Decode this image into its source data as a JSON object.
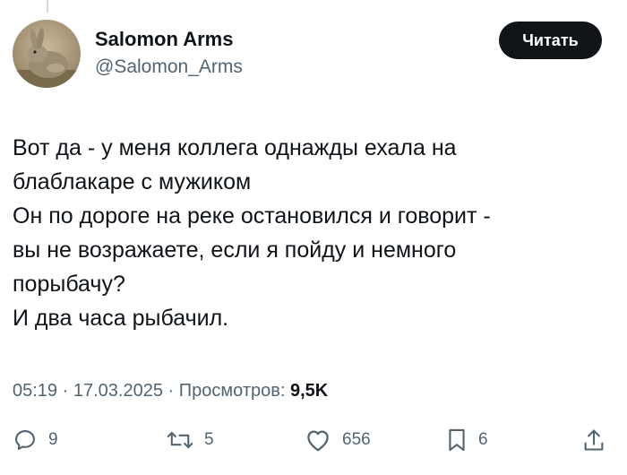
{
  "author": {
    "display_name": "Salomon Arms",
    "handle": "@Salomon_Arms",
    "avatar_icon": "rabbit-avatar"
  },
  "follow_button": {
    "label": "Читать"
  },
  "tweet": {
    "lines": [
      "Вот да - у меня коллега однажды ехала на",
      "блаблакаре с мужиком",
      "Он по дороге на реке остановился и говорит -",
      "вы не возражаете, если я пойду и немного",
      "порыбачу?",
      "И два часа рыбачил."
    ]
  },
  "meta": {
    "time": "05:19",
    "separator": "·",
    "date": "17.03.2025",
    "views_label": "Просмотров:",
    "views_count": "9,5K"
  },
  "actions": {
    "replies": "9",
    "reposts": "5",
    "likes": "656",
    "bookmarks": "6"
  },
  "colors": {
    "text": "#0f1419",
    "secondary": "#536471",
    "button_bg": "#0f1419"
  }
}
